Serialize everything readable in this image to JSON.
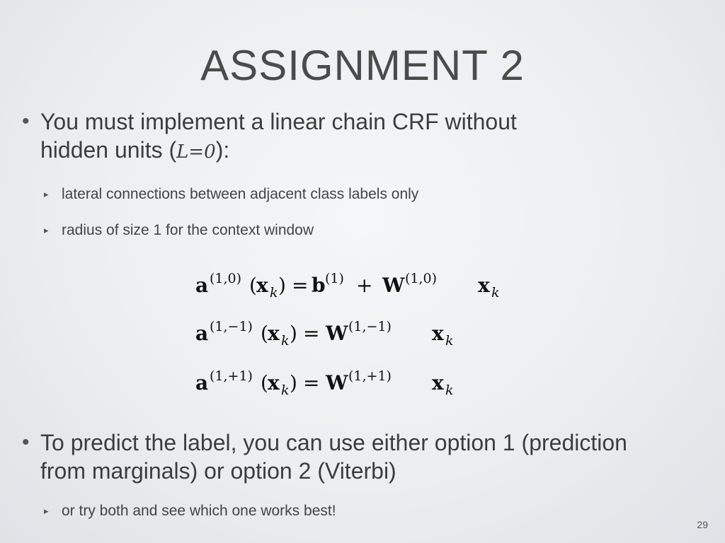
{
  "slide": {
    "title": "ASSIGNMENT 2",
    "bullet1": {
      "line1": "You must implement a linear chain CRF without",
      "line2_prefix": "hidden units (",
      "math": "L=0",
      "line2_suffix": "):"
    },
    "sub1": "lateral connections between adjacent class labels only",
    "sub2": "radius of size 1 for the context window",
    "equations": {
      "eq1": {
        "lhs_sup": "(1,0)",
        "rhs_b_sup": "(1)",
        "rhs_w_sup": "(1,0)"
      },
      "eq2": {
        "lhs_sup": "(1,−1)",
        "rhs_w_sup": "(1,−1)"
      },
      "eq3": {
        "lhs_sup": "(1,+1)",
        "rhs_w_sup": "(1,+1)"
      }
    },
    "bullet2": {
      "line1": "To predict the label, you can use either option 1 (prediction",
      "line2": "from marginals) or option 2 (Viterbi)"
    },
    "sub3": "or try both and see which one works best!",
    "page_number": "29"
  },
  "icons": {
    "bullet": "bullet-dot-icon",
    "sub_bullet": "triangle-arrow-icon"
  }
}
